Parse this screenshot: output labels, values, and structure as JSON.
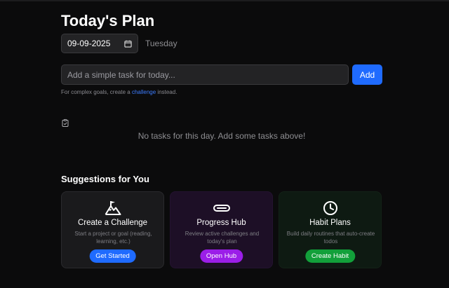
{
  "header": {
    "title": "Today's Plan"
  },
  "date_picker": {
    "value": "09-09-2025",
    "weekday": "Tuesday"
  },
  "task_form": {
    "placeholder": "Add a simple task for today...",
    "add_label": "Add",
    "hint_before": "For complex goals, create a ",
    "hint_link": "challenge",
    "hint_after": " instead."
  },
  "tasks": {
    "empty_message": "No tasks for this day. Add some tasks above!"
  },
  "suggestions": {
    "heading": "Suggestions for You",
    "cards": [
      {
        "icon": "mountain-flag-icon",
        "title": "Create a Challenge",
        "description": "Start a project or goal (reading, learning, etc.)",
        "button": "Get Started",
        "color": "#1f6bff"
      },
      {
        "icon": "progress-bar-icon",
        "title": "Progress Hub",
        "description": "Review active challenges and today's plan",
        "button": "Open Hub",
        "color": "#9b1ee8"
      },
      {
        "icon": "clock-icon",
        "title": "Habit Plans",
        "description": "Build daily routines that auto-create todos",
        "button": "Create Habit",
        "color": "#12a03a"
      }
    ]
  }
}
